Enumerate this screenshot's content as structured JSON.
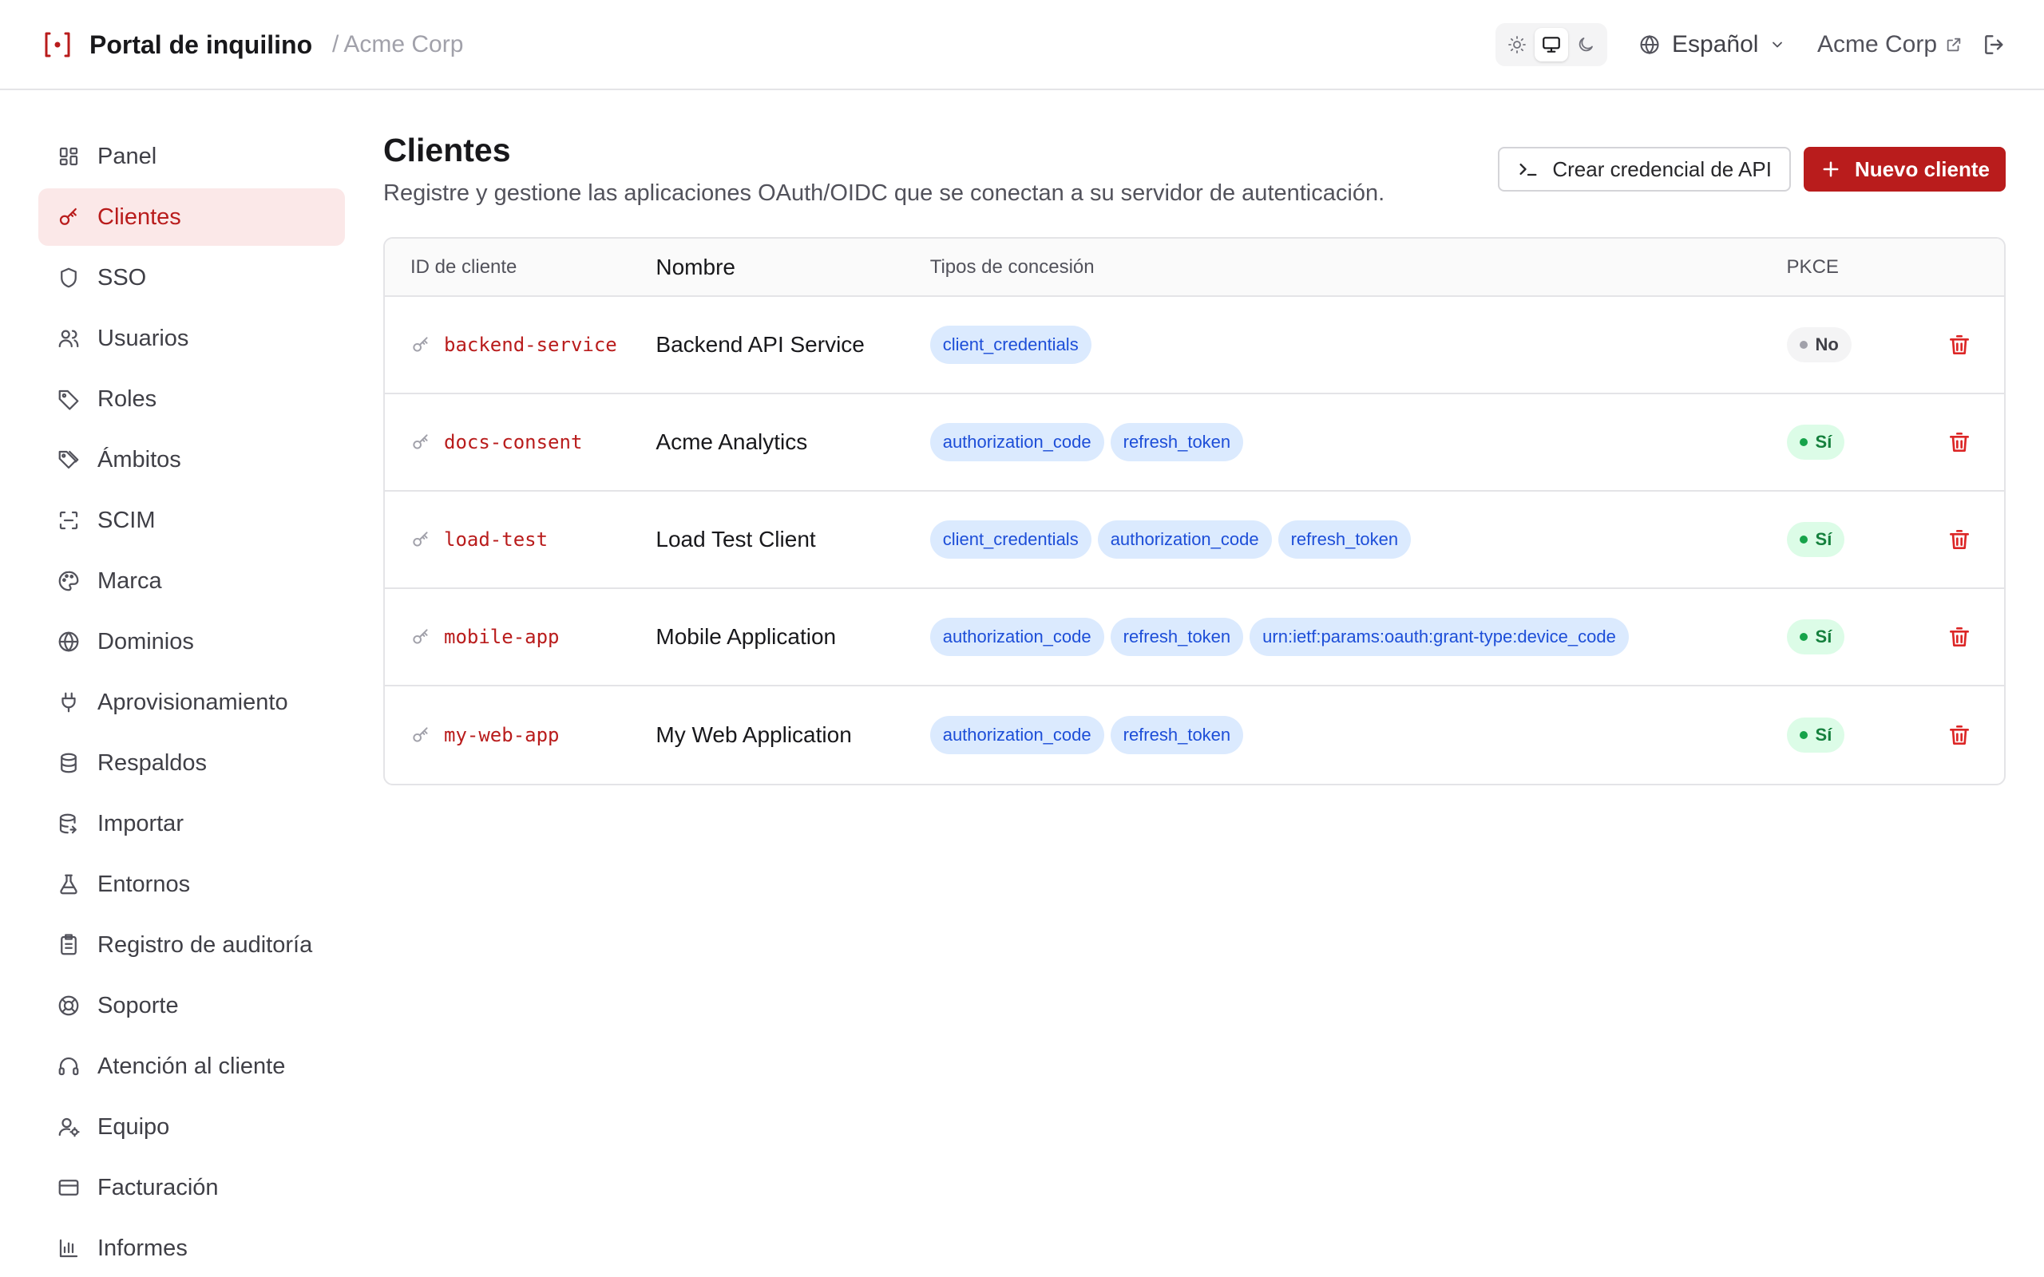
{
  "header": {
    "title": "Portal de inquilino",
    "breadcrumb_sep": "/",
    "tenant": "Acme Corp",
    "language": "Español",
    "tenant_link": "Acme Corp",
    "theme_modes": [
      "light",
      "system",
      "dark"
    ],
    "active_theme": "system"
  },
  "sidebar": {
    "items": [
      {
        "label": "Panel",
        "icon": "dashboard-icon"
      },
      {
        "label": "Clientes",
        "icon": "key-icon",
        "active": true
      },
      {
        "label": "SSO",
        "icon": "shield-icon"
      },
      {
        "label": "Usuarios",
        "icon": "users-icon"
      },
      {
        "label": "Roles",
        "icon": "tag-icon"
      },
      {
        "label": "Ámbitos",
        "icon": "tags-icon"
      },
      {
        "label": "SCIM",
        "icon": "scan-icon"
      },
      {
        "label": "Marca",
        "icon": "palette-icon"
      },
      {
        "label": "Dominios",
        "icon": "globe-icon"
      },
      {
        "label": "Aprovisionamiento",
        "icon": "plug-icon"
      },
      {
        "label": "Respaldos",
        "icon": "database-icon"
      },
      {
        "label": "Importar",
        "icon": "database-import-icon"
      },
      {
        "label": "Entornos",
        "icon": "flask-icon"
      },
      {
        "label": "Registro de auditoría",
        "icon": "clipboard-icon"
      },
      {
        "label": "Soporte",
        "icon": "lifebuoy-icon"
      },
      {
        "label": "Atención al cliente",
        "icon": "headset-icon"
      },
      {
        "label": "Equipo",
        "icon": "user-cog-icon"
      },
      {
        "label": "Facturación",
        "icon": "credit-card-icon"
      },
      {
        "label": "Informes",
        "icon": "bar-chart-icon"
      }
    ]
  },
  "main": {
    "title": "Clientes",
    "subtitle": "Registre y gestione las aplicaciones OAuth/OIDC que se conectan a su servidor de autenticación.",
    "create_api_credential_label": "Crear credencial de API",
    "new_client_label": "Nuevo cliente",
    "table": {
      "columns": [
        "ID de cliente",
        "Nombre",
        "Tipos de concesión",
        "PKCE"
      ],
      "rows": [
        {
          "client_id": "backend-service",
          "name": "Backend API Service",
          "grants": [
            "client_credentials"
          ],
          "pkce": "No",
          "pkce_enabled": false
        },
        {
          "client_id": "docs-consent",
          "name": "Acme Analytics",
          "grants": [
            "authorization_code",
            "refresh_token"
          ],
          "pkce": "Sí",
          "pkce_enabled": true
        },
        {
          "client_id": "load-test",
          "name": "Load Test Client",
          "grants": [
            "client_credentials",
            "authorization_code",
            "refresh_token"
          ],
          "pkce": "Sí",
          "pkce_enabled": true
        },
        {
          "client_id": "mobile-app",
          "name": "Mobile Application",
          "grants": [
            "authorization_code",
            "refresh_token",
            "urn:ietf:params:oauth:grant-type:device_code"
          ],
          "pkce": "Sí",
          "pkce_enabled": true
        },
        {
          "client_id": "my-web-app",
          "name": "My Web Application",
          "grants": [
            "authorization_code",
            "refresh_token"
          ],
          "pkce": "Sí",
          "pkce_enabled": true
        }
      ]
    }
  },
  "colors": {
    "accent": "#b91c1c",
    "accent_soft": "#fbe8e8",
    "grant_bg": "#dbeafe",
    "grant_text": "#1d4ed8",
    "pkce_yes_bg": "#dcfce7",
    "pkce_yes_text": "#15803d"
  }
}
